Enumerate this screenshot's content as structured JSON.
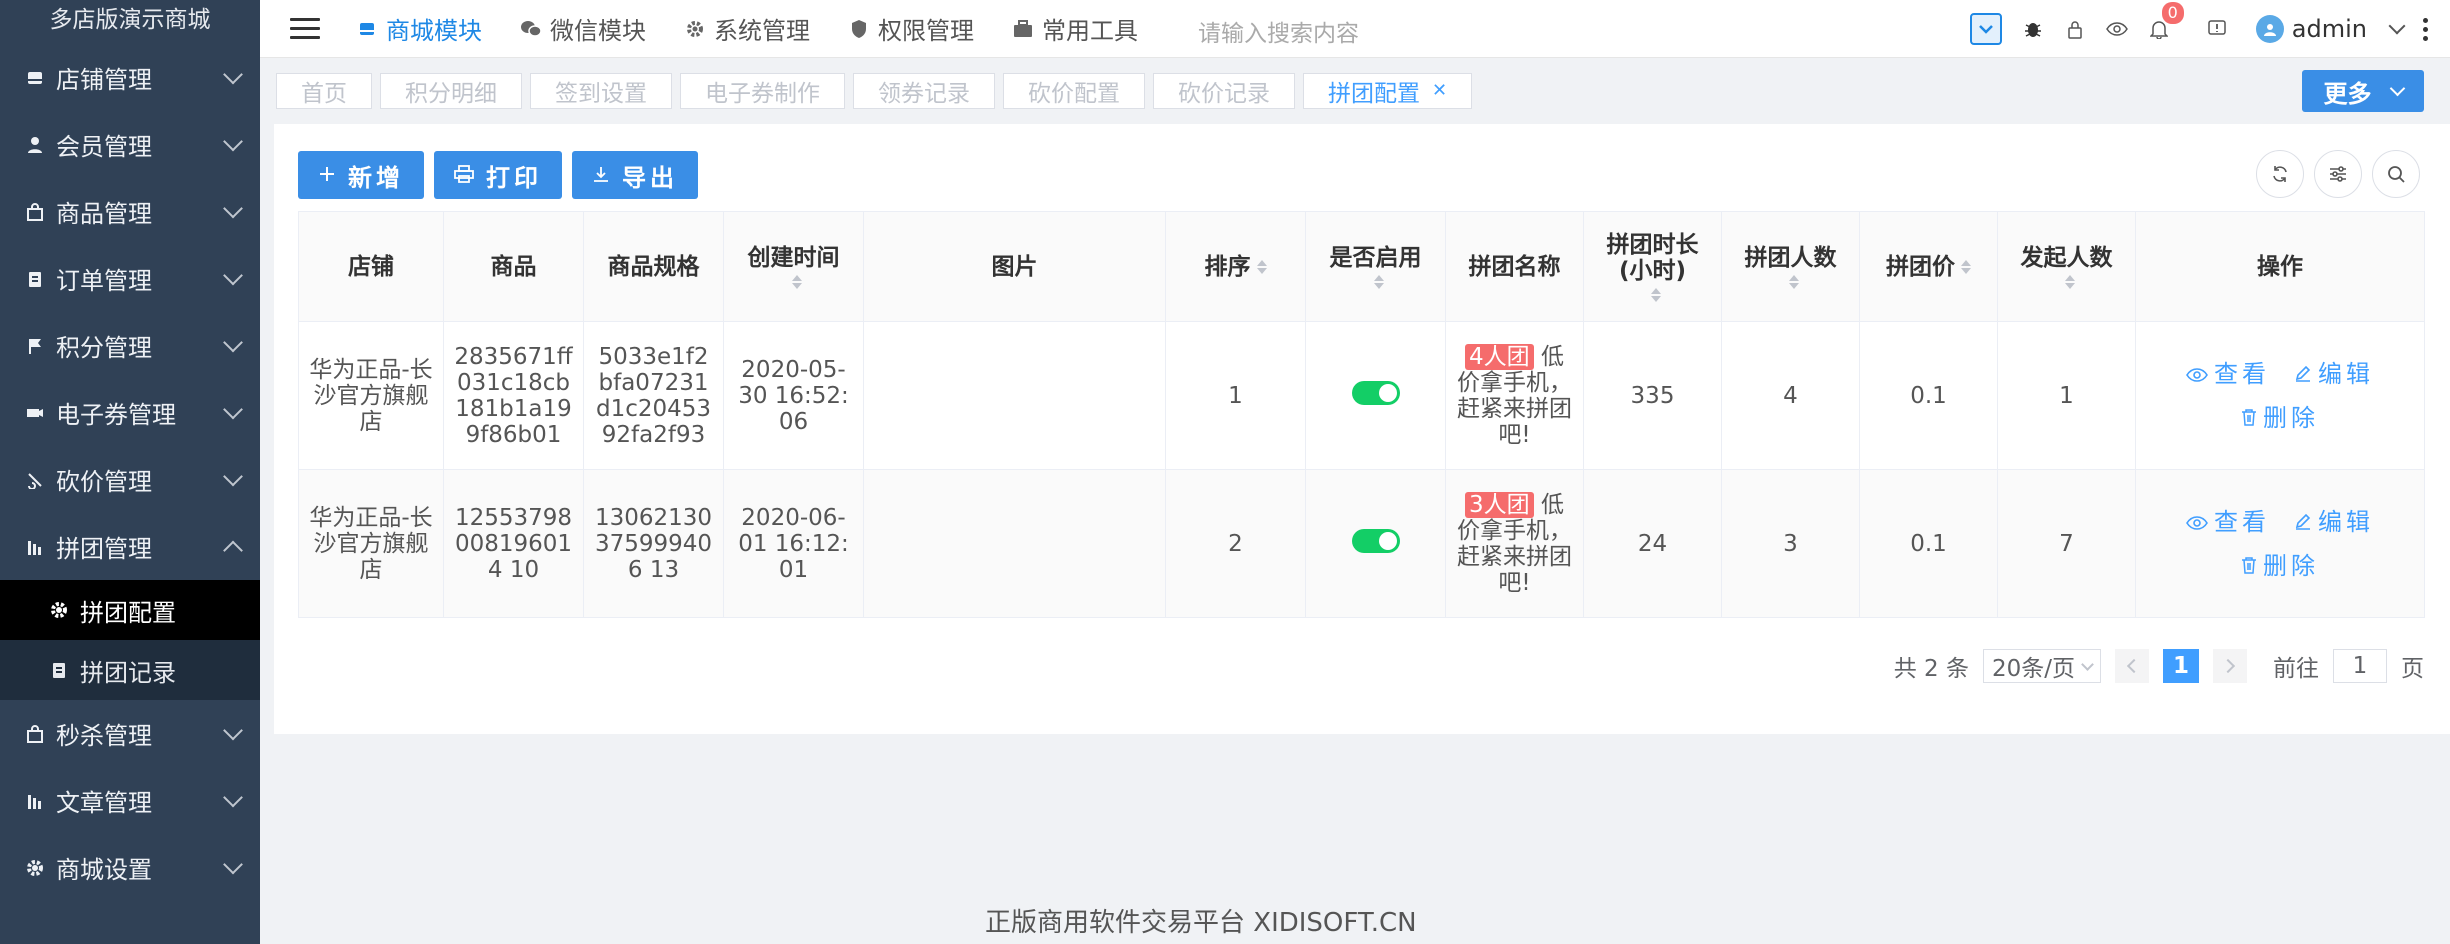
{
  "brand": "多店版演示商城",
  "sidebar": {
    "items": [
      {
        "label": "店铺管理",
        "icon": "store-icon"
      },
      {
        "label": "会员管理",
        "icon": "user-icon"
      },
      {
        "label": "商品管理",
        "icon": "bag-icon"
      },
      {
        "label": "订单管理",
        "icon": "clipboard-icon"
      },
      {
        "label": "积分管理",
        "icon": "flag-icon"
      },
      {
        "label": "电子券管理",
        "icon": "ticket-icon"
      },
      {
        "label": "砍价管理",
        "icon": "cut-icon"
      },
      {
        "label": "拼团管理",
        "icon": "chart-icon"
      }
    ],
    "sub_items": [
      {
        "label": "拼团配置",
        "icon": "gear-icon"
      },
      {
        "label": "拼团记录",
        "icon": "clipboard-icon"
      }
    ],
    "items_after": [
      {
        "label": "秒杀管理",
        "icon": "bag-icon"
      },
      {
        "label": "文章管理",
        "icon": "chart-icon"
      },
      {
        "label": "商城设置",
        "icon": "gear-icon"
      }
    ]
  },
  "header": {
    "nav": [
      "商城模块",
      "微信模块",
      "系统管理",
      "权限管理",
      "常用工具"
    ],
    "search_placeholder": "请输入搜索内容",
    "badge": "0",
    "username": "admin"
  },
  "tags": [
    "首页",
    "积分明细",
    "签到设置",
    "电子券制作",
    "领券记录",
    "砍价配置",
    "砍价记录",
    "拼团配置"
  ],
  "more_label": "更多",
  "toolbar": {
    "add": "新增",
    "print": "打印",
    "export": "导出"
  },
  "table": {
    "headers": [
      "店铺",
      "商品",
      "商品规格",
      "创建时间",
      "图片",
      "排序",
      "是否启用",
      "拼团名称",
      "拼团时长(小时)",
      "拼团人数",
      "拼团价",
      "发起人数",
      "操作"
    ],
    "rows": [
      {
        "store": "华为正品-长沙官方旗舰店",
        "goods": "2835671ff031c18cb181b1a199f86b01",
        "spec": "5033e1f2bfa07231d1c2045392fa2f93",
        "created": "2020-05-30 16:52:06",
        "sort": "1",
        "enabled": true,
        "tag": "4人团",
        "name": "低价拿手机，赶紧来拼团吧!",
        "hours": "335",
        "people": "4",
        "price": "0.1",
        "initiators": "1"
      },
      {
        "store": "华为正品-长沙官方旗舰店",
        "goods": "12553798008196014 10",
        "spec": "13062130375999406 13",
        "created": "2020-06-01 16:12:01",
        "sort": "2",
        "enabled": true,
        "tag": "3人团",
        "name": "低价拿手机，赶紧来拼团吧!",
        "hours": "24",
        "people": "3",
        "price": "0.1",
        "initiators": "7"
      }
    ],
    "ops": {
      "view": "查看",
      "edit": "编辑",
      "delete": "删除"
    }
  },
  "pager": {
    "total": "共 2 条",
    "size": "20条/页",
    "current": "1",
    "goto_prefix": "前往",
    "goto_value": "1",
    "goto_suffix": "页"
  },
  "footer": "正版商用软件交易平台 XIDISOFT.CN",
  "colors": {
    "sidebar": "#304156",
    "accent": "#409eff",
    "success": "#13ce66",
    "danger": "#f56c6c"
  }
}
